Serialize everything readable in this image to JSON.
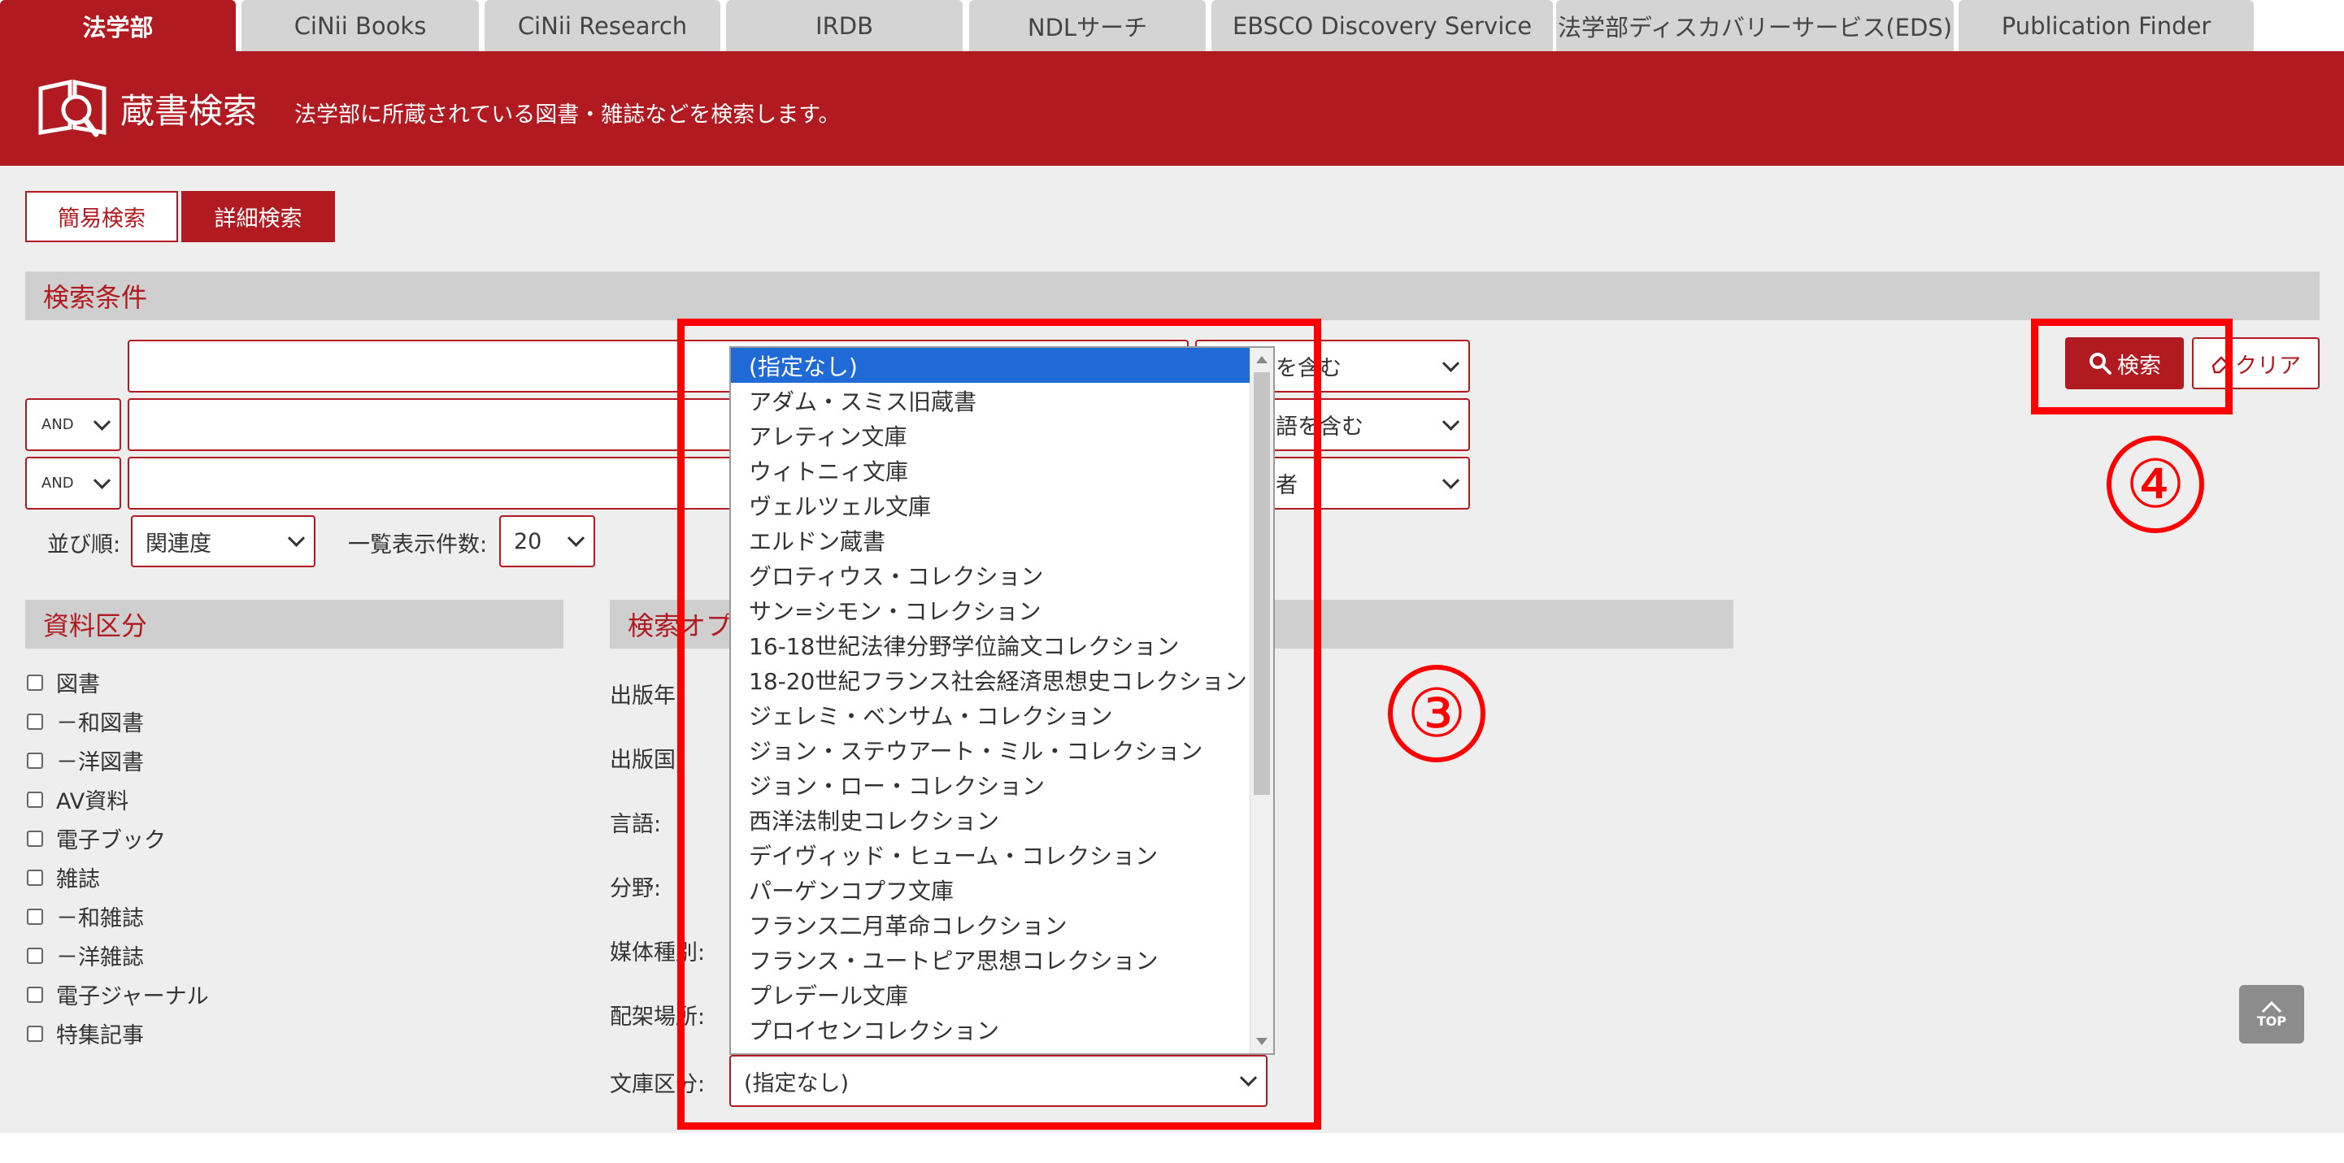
{
  "tabs": [
    {
      "label": "法学部",
      "active": true
    },
    {
      "label": "CiNii Books",
      "active": false
    },
    {
      "label": "CiNii Research",
      "active": false
    },
    {
      "label": "IRDB",
      "active": false
    },
    {
      "label": "NDLサーチ",
      "active": false
    },
    {
      "label": "EBSCO Discovery Service",
      "active": false
    },
    {
      "label": "法学部ディスカバリーサービス(EDS)",
      "active": false
    },
    {
      "label": "Publication Finder",
      "active": false
    }
  ],
  "header": {
    "title": "蔵書検索",
    "description": "法学部に所蔵されている図書・雑誌などを検索します。"
  },
  "mode_buttons": {
    "simple": "簡易検索",
    "detail": "詳細検索"
  },
  "search": {
    "section_title": "検索条件",
    "operators": [
      "AND",
      "AND"
    ],
    "condition_selects": [
      "左の語を含む",
      "に左の語を含む",
      "・出版者"
    ],
    "sort_label": "並び順:",
    "sort_value": "関連度",
    "per_page_label": "一覧表示件数:",
    "per_page_value": "20",
    "search_button": "検索",
    "clear_button": "クリア"
  },
  "material": {
    "section_title": "資料区分",
    "items": [
      "図書",
      "－和図書",
      "－洋図書",
      "AV資料",
      "電子ブック",
      "雑誌",
      "－和雑誌",
      "－洋雑誌",
      "電子ジャーナル",
      "特集記事"
    ]
  },
  "options": {
    "section_title": "検索オプ",
    "labels": [
      "出版年",
      "出版国",
      "言語:",
      "分野:",
      "媒体種別:",
      "配架場所:",
      "文庫区分:"
    ],
    "bunko_selected": "(指定なし)"
  },
  "dropdown": {
    "options": [
      "(指定なし)",
      "アダム・スミス旧蔵書",
      "アレティン文庫",
      "ウィトニィ文庫",
      "ヴェルツェル文庫",
      "エルドン蔵書",
      "グロティウス・コレクション",
      "サン=シモン・コレクション",
      "16-18世紀法律分野学位論文コレクション",
      "18-20世紀フランス社会経済思想史コレクション",
      "ジェレミ・ベンサム・コレクション",
      "ジョン・ステウアート・ミル・コレクション",
      "ジョン・ロー・コレクション",
      "西洋法制史コレクション",
      "デイヴィッド・ヒューム・コレクション",
      "パーゲンコプフ文庫",
      "フランス二月革命コレクション",
      "フランス・ユートピア思想コレクション",
      "プレデール文庫",
      "プロイセンコレクション"
    ],
    "selected_index": 0
  },
  "annotations": {
    "step3": "③",
    "step4": "④"
  },
  "top_button": "TOP",
  "colors": {
    "brand": "#b11a20",
    "highlight": "#ff0000",
    "selection": "#1f6ad6"
  }
}
